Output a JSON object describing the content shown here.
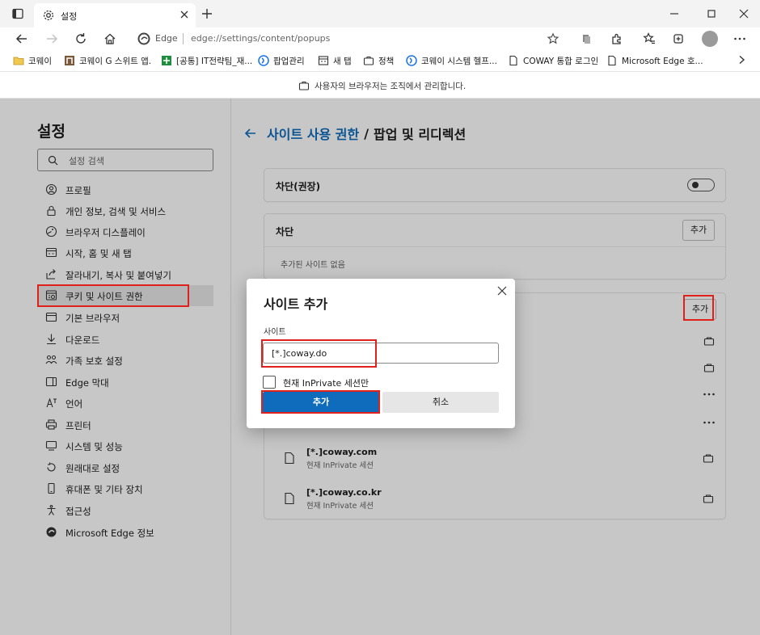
{
  "browser": {
    "tab_title": "설정",
    "omnibox_label": "Edge",
    "url": "edge://settings/content/popups"
  },
  "favorites": [
    {
      "label": "코웨이",
      "icon": "folder-icon"
    },
    {
      "label": "코웨이 G 스위트 앱.",
      "icon": "app-icon"
    },
    {
      "label": "[공통] IT전략팀_재...",
      "icon": "sheet-icon"
    },
    {
      "label": "팝업관리",
      "icon": "coway-icon"
    },
    {
      "label": "새 탭",
      "icon": "newtab-icon"
    },
    {
      "label": "정책",
      "icon": "briefcase-icon"
    },
    {
      "label": "코웨이 시스템 헬프...",
      "icon": "coway-icon"
    },
    {
      "label": "COWAY 통합 로그인",
      "icon": "page-icon"
    },
    {
      "label": "Microsoft Edge 호...",
      "icon": "page-icon"
    }
  ],
  "banner": {
    "text": "사용자의 브라우저는 조직에서 관리합니다."
  },
  "sidebar": {
    "title": "설정",
    "search_placeholder": "설정 검색",
    "items": [
      {
        "label": "프로필",
        "icon": "profile-icon"
      },
      {
        "label": "개인 정보, 검색 및 서비스",
        "icon": "lock-icon"
      },
      {
        "label": "브라우저 디스플레이",
        "icon": "appearance-icon"
      },
      {
        "label": "시작, 홈 및 새 탭",
        "icon": "start-icon"
      },
      {
        "label": "잘라내기, 복사 및 붙여넣기",
        "icon": "share-icon"
      },
      {
        "label": "쿠키 및 사이트 권한",
        "icon": "cookies-icon"
      },
      {
        "label": "기본 브라우저",
        "icon": "browser-icon"
      },
      {
        "label": "다운로드",
        "icon": "download-icon"
      },
      {
        "label": "가족 보호 설정",
        "icon": "family-icon"
      },
      {
        "label": "Edge 막대",
        "icon": "edgebar-icon"
      },
      {
        "label": "언어",
        "icon": "language-icon"
      },
      {
        "label": "프린터",
        "icon": "printer-icon"
      },
      {
        "label": "시스템 및 성능",
        "icon": "system-icon"
      },
      {
        "label": "원래대로 설정",
        "icon": "reset-icon"
      },
      {
        "label": "휴대폰 및 기타 장치",
        "icon": "phone-icon"
      },
      {
        "label": "접근성",
        "icon": "accessibility-icon"
      },
      {
        "label": "Microsoft Edge 정보",
        "icon": "edge-logo-icon"
      }
    ]
  },
  "main": {
    "breadcrumb_link": "사이트 사용 권한",
    "breadcrumb_sep": "/",
    "breadcrumb_current": "팝업 및 리디렉션",
    "block_recommended_label": "차단(권장)",
    "block_section_title": "차단",
    "block_add_label": "추가",
    "block_empty": "추가된 사이트 없음",
    "allow_add_label": "추가",
    "allow_sites": [
      {
        "site": "[*.]coway.com",
        "sub": "현재 InPrivate 세션"
      },
      {
        "site": "[*.]coway.co.kr",
        "sub": "현재 InPrivate 세션"
      }
    ]
  },
  "dialog": {
    "title": "사이트 추가",
    "field_label": "사이트",
    "input_value": "[*.]coway.do",
    "checkbox_label": "현재 InPrivate 세션만",
    "add_label": "추가",
    "cancel_label": "취소"
  },
  "colors": {
    "accent": "#0f6cbd",
    "highlight": "#e0201b"
  }
}
